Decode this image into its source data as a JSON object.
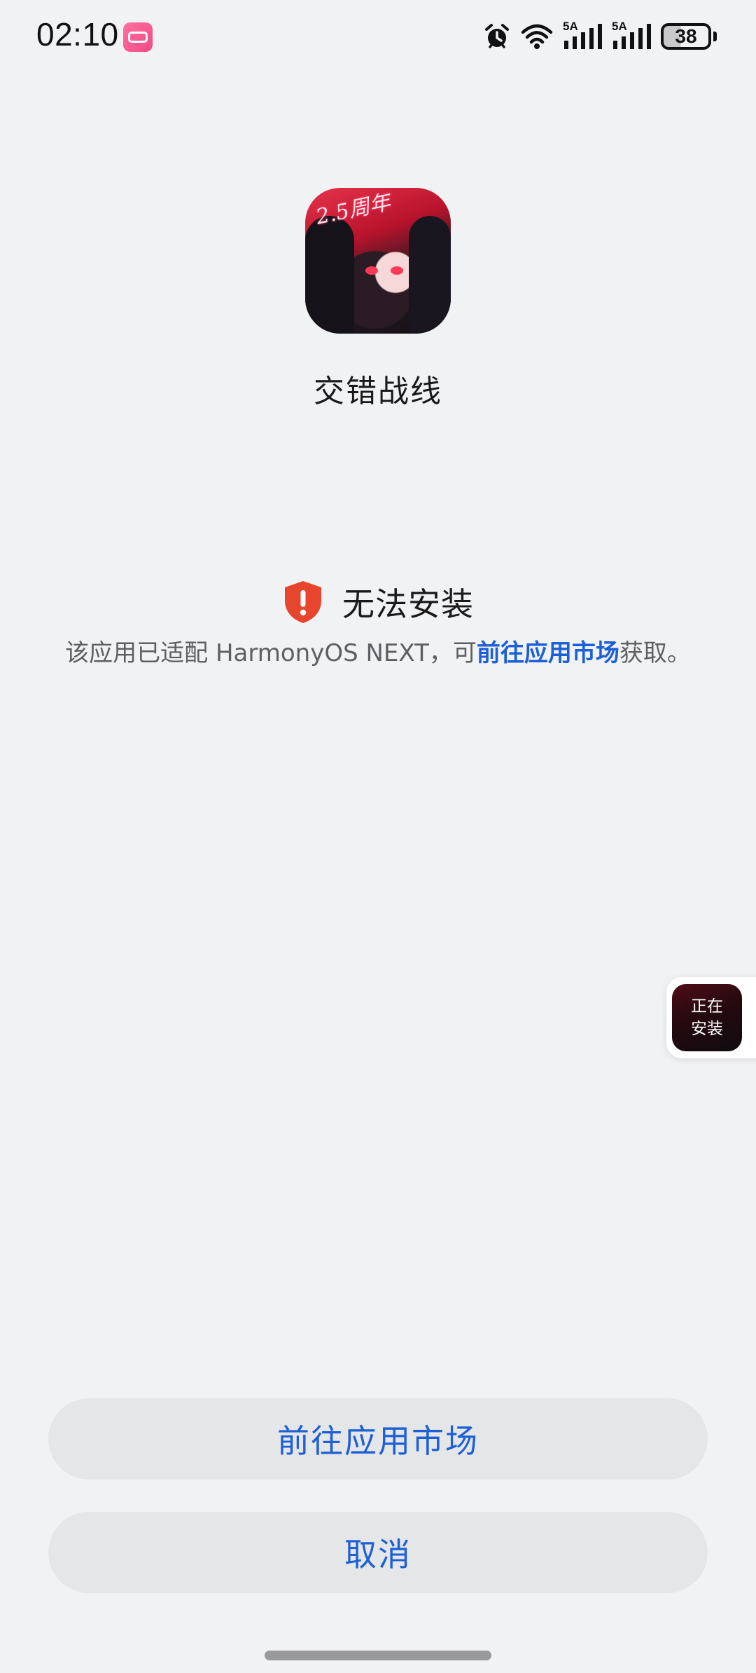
{
  "status_bar": {
    "time": "02:10",
    "signal_1_label": "5A",
    "signal_2_label": "5A",
    "battery_level": "38"
  },
  "app": {
    "name": "交错战线",
    "icon_badge": "2.5周年"
  },
  "error": {
    "title": "无法安装",
    "desc_prefix": "该应用已适配 HarmonyOS NEXT，可",
    "desc_link": "前往应用市场",
    "desc_suffix": "获取。"
  },
  "float_widget": {
    "line1": "正在",
    "line2": "安装"
  },
  "buttons": {
    "market": "前往应用市场",
    "cancel": "取消"
  },
  "colors": {
    "background": "#f1f2f4",
    "accent": "#1c5fd6",
    "warning": "#e8452f",
    "button_bg": "#e5e6e8"
  }
}
